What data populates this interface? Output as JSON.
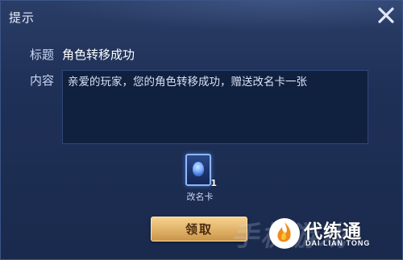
{
  "dialog": {
    "title": "提示",
    "close_icon": "close-icon"
  },
  "mail": {
    "title_label": "标题",
    "title_value": "角色转移成功",
    "content_label": "内容",
    "content_text": "亲爱的玩家，您的角色转移成功，赠送改名卡一张"
  },
  "reward": {
    "item_name": "改名卡",
    "quantity": "1",
    "icon": "rename-card-icon"
  },
  "actions": {
    "claim_label": "领取"
  },
  "watermark": {
    "ghost_text": "手机游戏",
    "main": "代练通",
    "sub": "DAI LIAN TONG"
  },
  "colors": {
    "panel_bg": "#1f3057",
    "button_gold": "#e0b268",
    "button_text": "#4a2a10",
    "text_primary": "#ffffff",
    "text_label": "#c9d6f2"
  }
}
